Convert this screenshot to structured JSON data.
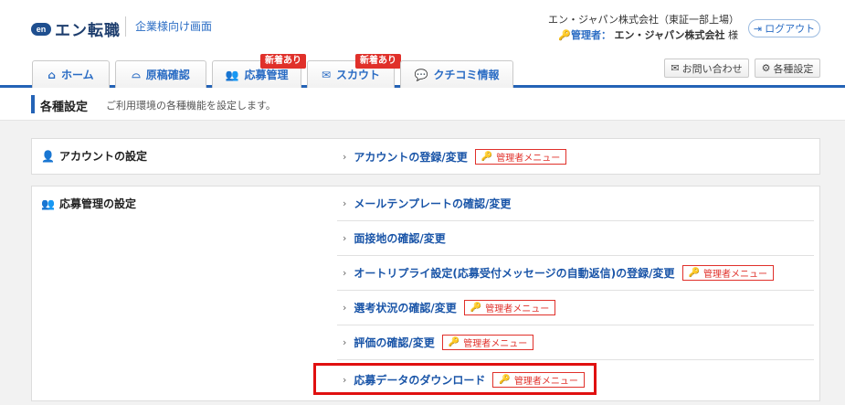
{
  "header": {
    "logo_mark": "en",
    "logo_text": "エン転職",
    "logo_sub": "企業様向け画面",
    "company": "エン・ジャパン株式会社（東証一部上場）",
    "admin_label": "管理者：",
    "admin_name": "エン・ジャパン株式会社",
    "admin_suffix": "様",
    "logout_label": "ログアウト"
  },
  "nav": {
    "tabs": [
      {
        "label": "ホーム",
        "icon": "home-icon"
      },
      {
        "label": "原稿確認",
        "icon": "hat-icon"
      },
      {
        "label": "応募管理",
        "icon": "users-icon",
        "badge": "新着あり"
      },
      {
        "label": "スカウト",
        "icon": "mail-icon",
        "badge": "新着あり"
      },
      {
        "label": "クチコミ情報",
        "icon": "chat-icon"
      }
    ],
    "contact_label": "お問い合わせ",
    "settings_label": "各種設定"
  },
  "page": {
    "title": "各種設定",
    "description": "ご利用環境の各種機能を設定します。"
  },
  "admin_tag_label": "管理者メニュー",
  "sections": [
    {
      "title": "アカウントの設定",
      "icon": "user-icon",
      "items": [
        {
          "label": "アカウントの登録/変更",
          "admin": true
        }
      ]
    },
    {
      "title": "応募管理の設定",
      "icon": "users-icon",
      "items": [
        {
          "label": "メールテンプレートの確認/変更",
          "admin": false
        },
        {
          "label": "面接地の確認/変更",
          "admin": false
        },
        {
          "label": "オートリプライ設定(応募受付メッセージの自動返信)の登録/変更",
          "admin": true
        },
        {
          "label": "選考状況の確認/変更",
          "admin": true
        },
        {
          "label": "評価の確認/変更",
          "admin": true
        },
        {
          "label": "応募データのダウンロード",
          "admin": true
        }
      ]
    }
  ],
  "colors": {
    "accent": "#2463b6",
    "link": "#1a55a8",
    "admin_red": "#e0302a",
    "highlight": "#e01010"
  }
}
